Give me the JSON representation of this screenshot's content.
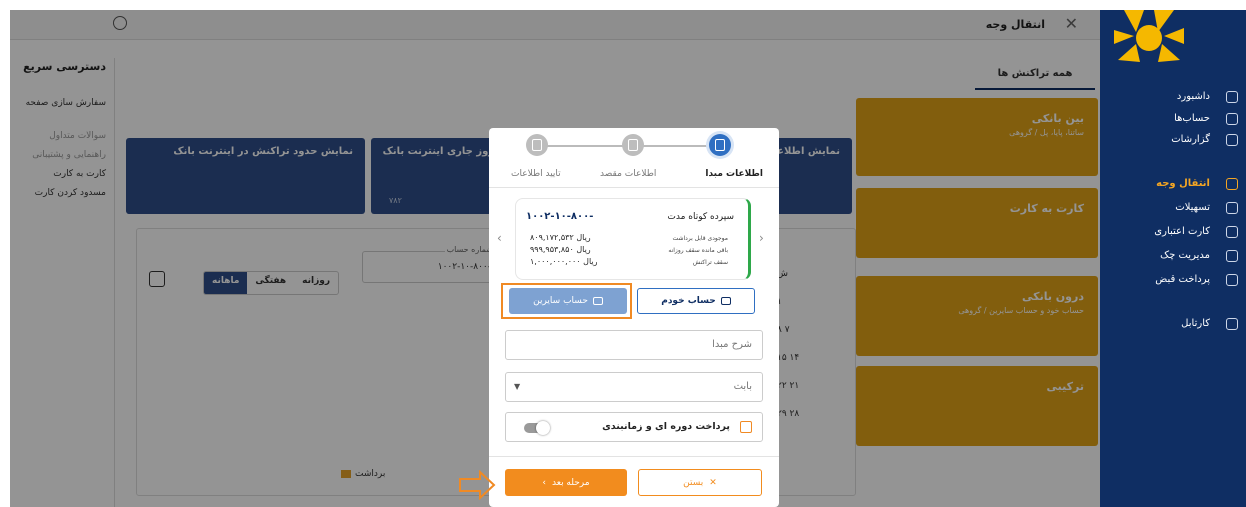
{
  "header": {
    "title": "انتقال وجه"
  },
  "sidebar": {
    "items": [
      {
        "label": "داشبورد",
        "icon": "dashboard-icon"
      },
      {
        "label": "حساب‌ها",
        "icon": "accounts-icon"
      },
      {
        "label": "گزارشات",
        "icon": "reports-icon"
      },
      {
        "label": "انتقال وجه",
        "icon": "transfer-icon",
        "active": true
      },
      {
        "label": "تسهیلات",
        "icon": "loans-icon"
      },
      {
        "label": "کارت اعتباری",
        "icon": "credit-card-icon"
      },
      {
        "label": "مدیریت چک",
        "icon": "cheque-icon"
      },
      {
        "label": "پرداخت قبض",
        "icon": "bill-icon"
      },
      {
        "label": "کارتابل",
        "icon": "cartable-icon"
      }
    ]
  },
  "quick_access": {
    "title": "دسترسی سریع",
    "items": [
      {
        "label": "سفارش سازی صفحه"
      },
      {
        "label": "سوالات متداول"
      },
      {
        "label": "راهنمایی و پشتیبانی"
      },
      {
        "label": "کارت به کارت"
      },
      {
        "label": "مسدود کردن کارت"
      }
    ]
  },
  "tabs": {
    "all": "همه تراکنش ها"
  },
  "cards": [
    {
      "title": "بین بانکی",
      "subtitle": "ساتنا، پایا، پل / گروهی"
    },
    {
      "title": "کارت به کارت",
      "subtitle": ""
    },
    {
      "title": "درون بانکی",
      "subtitle": "حساب خود و حساب سایرین / گروهی"
    },
    {
      "title": "ترکیبی",
      "subtitle": ""
    }
  ],
  "info_cards": [
    {
      "title": "نمایش اطلاعات حساب‌ها",
      "value": ""
    },
    {
      "title": "مجموع تراکنش های روز جاری اینترنت بانک",
      "value": "۷۸۲"
    },
    {
      "title": "نمایش حدود تراکنش در اینترنت بانک",
      "value": ""
    }
  ],
  "panel": {
    "account_label": "شماره حساب",
    "account_value": "۱۰۰۲-۱۰-۸۰۰-",
    "segments": [
      "روزانه",
      "هفتگی",
      "ماهانه"
    ],
    "active_segment": "ماهانه",
    "legend": "برداشت",
    "calendar_rows": [
      "ش",
      "۱",
      "۸  ۷",
      "۱۵  ۱۴",
      "۲۲  ۲۱",
      "۲۹  ۲۸"
    ]
  },
  "modal": {
    "steps": [
      {
        "label": "اطلاعات مبدا",
        "active": true
      },
      {
        "label": "اطلاعات مقصد",
        "active": false
      },
      {
        "label": "تایید اطلاعات",
        "active": false
      }
    ],
    "account": {
      "number": "۱۰۰۲-۱۰-۸۰۰-",
      "name": "سپرده کوتاه مدت",
      "rows": [
        {
          "key": "موجودی قابل برداشت",
          "value": "۸۰۹,۱۷۲,۵۳۲ ریال"
        },
        {
          "key": "باقی مانده سقف روزانه",
          "value": "۹۹۹,۹۵۳,۸۵۰ ریال"
        },
        {
          "key": "سقف تراکنش",
          "value": "۱,۰۰۰,۰۰۰,۰۰۰ ریال"
        }
      ]
    },
    "own_account_label": "حساب خودم",
    "others_account_label": "حساب سایرین",
    "description_placeholder": "شرح مبدا",
    "purpose_placeholder": "بابت",
    "periodic_label": "پرداخت دوره ای و زمانبندی",
    "periodic_enabled": false,
    "next_label": "مرحله بعد",
    "close_label": "بستن"
  },
  "colors": {
    "sidebar": "#0f2e63",
    "accent": "#f28c1e",
    "card": "#e0a317",
    "primary": "#2f6fc2"
  }
}
